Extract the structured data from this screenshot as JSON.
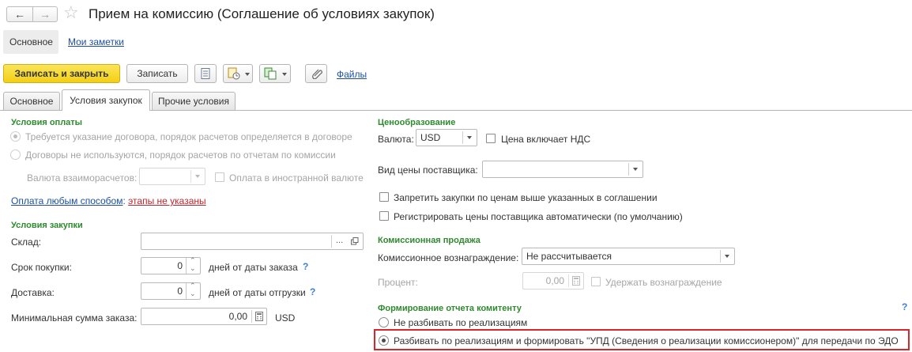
{
  "header": {
    "title": "Прием на комиссию (Соглашение об условиях закупок)"
  },
  "nav": {
    "main": "Основное",
    "notes": "Мои заметки"
  },
  "toolbar": {
    "save_close": "Записать и закрыть",
    "save": "Записать",
    "files": "Файлы"
  },
  "tabs": [
    "Основное",
    "Условия закупок",
    "Прочие условия"
  ],
  "payment": {
    "title": "Условия оплаты",
    "opt1": "Требуется указание договора, порядок расчетов определяется в договоре",
    "opt2": "Договоры не используются, порядок расчетов по отчетам по комиссии",
    "currency_label": "Валюта взаиморасчетов:",
    "foreign_label": "Оплата в иностранной валюте",
    "link_pay": "Оплата любым способом",
    "colon": ":",
    "link_stages": "этапы не указаны"
  },
  "purchase": {
    "title": "Условия закупки",
    "warehouse_label": "Склад:",
    "period_label": "Срок покупки:",
    "period_value": "0",
    "period_unit": "дней от даты заказа",
    "delivery_label": "Доставка:",
    "delivery_value": "0",
    "delivery_unit": "дней от даты отгрузки",
    "min_label": "Минимальная сумма заказа:",
    "min_value": "0,00",
    "min_currency": "USD",
    "help": "?"
  },
  "pricing": {
    "title": "Ценообразование",
    "currency_label": "Валюта:",
    "currency_value": "USD",
    "vat_label": "Цена включает НДС",
    "price_type_label": "Вид цены поставщика:",
    "price_type_value": "",
    "forbid_label": "Запретить закупки по ценам выше указанных в соглашении",
    "register_label": "Регистрировать цены поставщика автоматически (по умолчанию)"
  },
  "commission": {
    "title": "Комиссионная продажа",
    "reward_label": "Комиссионное вознаграждение:",
    "reward_value": "Не рассчитывается",
    "percent_label": "Процент:",
    "percent_value": "0,00",
    "hold_label": "Удержать вознаграждение"
  },
  "report": {
    "title": "Формирование отчета комитенту",
    "help": "?",
    "opt1": "Не разбивать по реализациям",
    "opt2": "Разбивать по реализациям и формировать \"УПД  (Сведения о реализации комиссионером)\" для передачи по ЭДО"
  },
  "colors": {
    "accent_yellow": "#f9d821",
    "section_green": "#2e8a2e",
    "link_blue": "#1c4fa3",
    "link_red": "#c0262c",
    "highlight_red": "#d9262b"
  }
}
